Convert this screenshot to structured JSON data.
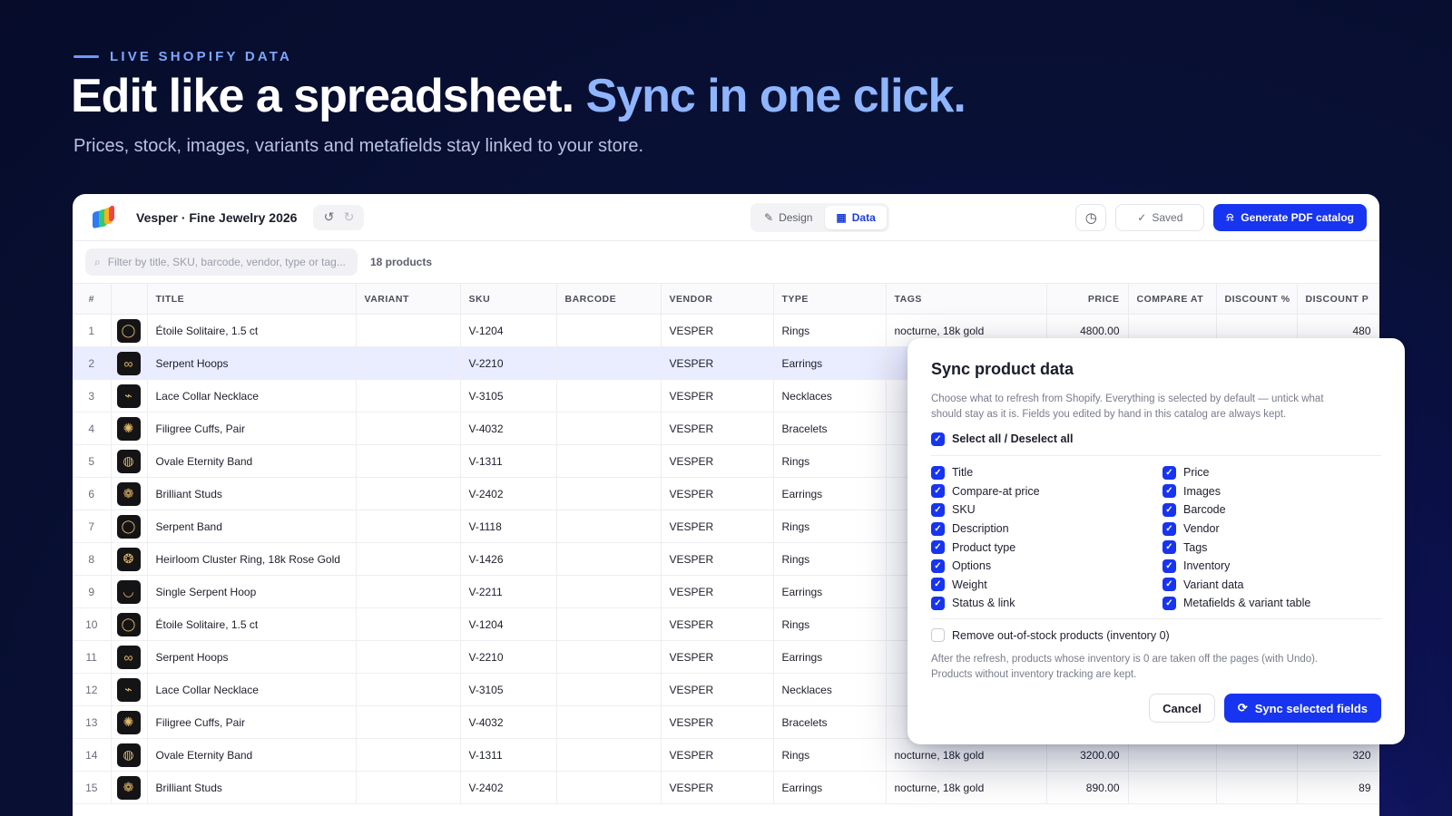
{
  "hero": {
    "eyebrow": "LIVE SHOPIFY DATA",
    "headline_main": "Edit like a spreadsheet.",
    "headline_accent": "Sync in one click.",
    "subhead": "Prices, stock, images, variants and metafields stay linked to your store."
  },
  "colors": {
    "accent": "#1734f0",
    "accent_light": "#8fb5ff",
    "background": "#081035"
  },
  "toolbar": {
    "doc_title": "Vesper · Fine Jewelry 2026",
    "undo_icon": "undo-icon",
    "redo_icon": "redo-icon",
    "modes": [
      {
        "label": "Design",
        "icon": "pencil-icon",
        "active": false
      },
      {
        "label": "Data",
        "icon": "table-icon",
        "active": true
      }
    ],
    "history_icon": "clock-icon",
    "saved_label": "Saved",
    "generate_label": "Generate PDF catalog"
  },
  "filter": {
    "placeholder": "Filter by title, SKU, barcode, vendor, type or tag...",
    "count": "18 products"
  },
  "table": {
    "columns": [
      "#",
      "",
      "TITLE",
      "VARIANT",
      "SKU",
      "BARCODE",
      "VENDOR",
      "TYPE",
      "TAGS",
      "PRICE",
      "COMPARE AT",
      "DISCOUNT %",
      "DISCOUNT P"
    ],
    "rows": [
      {
        "n": "1",
        "title": "Étoile Solitaire, 1.5 ct",
        "sku": "V-1204",
        "vendor": "VESPER",
        "type": "Rings",
        "tags": "nocturne, 18k gold",
        "price": "4800.00",
        "disc_p": "480"
      },
      {
        "n": "2",
        "title": "Serpent Hoops",
        "sku": "V-2210",
        "vendor": "VESPER",
        "type": "Earrings",
        "tags": "",
        "price": "",
        "disc_p": ""
      },
      {
        "n": "3",
        "title": "Lace Collar Necklace",
        "sku": "V-3105",
        "vendor": "VESPER",
        "type": "Necklaces",
        "tags": "",
        "price": "",
        "disc_p": ""
      },
      {
        "n": "4",
        "title": "Filigree Cuffs, Pair",
        "sku": "V-4032",
        "vendor": "VESPER",
        "type": "Bracelets",
        "tags": "",
        "price": "",
        "disc_p": ""
      },
      {
        "n": "5",
        "title": "Ovale Eternity Band",
        "sku": "V-1311",
        "vendor": "VESPER",
        "type": "Rings",
        "tags": "",
        "price": "",
        "disc_p": ""
      },
      {
        "n": "6",
        "title": "Brilliant Studs",
        "sku": "V-2402",
        "vendor": "VESPER",
        "type": "Earrings",
        "tags": "",
        "price": "",
        "disc_p": ""
      },
      {
        "n": "7",
        "title": "Serpent Band",
        "sku": "V-1118",
        "vendor": "VESPER",
        "type": "Rings",
        "tags": "",
        "price": "",
        "disc_p": ""
      },
      {
        "n": "8",
        "title": "Heirloom Cluster Ring, 18k Rose Gold",
        "sku": "V-1426",
        "vendor": "VESPER",
        "type": "Rings",
        "tags": "",
        "price": "",
        "disc_p": ""
      },
      {
        "n": "9",
        "title": "Single Serpent Hoop",
        "sku": "V-2211",
        "vendor": "VESPER",
        "type": "Earrings",
        "tags": "",
        "price": "",
        "disc_p": ""
      },
      {
        "n": "10",
        "title": "Étoile Solitaire, 1.5 ct",
        "sku": "V-1204",
        "vendor": "VESPER",
        "type": "Rings",
        "tags": "",
        "price": "",
        "disc_p": ""
      },
      {
        "n": "11",
        "title": "Serpent Hoops",
        "sku": "V-2210",
        "vendor": "VESPER",
        "type": "Earrings",
        "tags": "",
        "price": "",
        "disc_p": ""
      },
      {
        "n": "12",
        "title": "Lace Collar Necklace",
        "sku": "V-3105",
        "vendor": "VESPER",
        "type": "Necklaces",
        "tags": "",
        "price": "",
        "disc_p": ""
      },
      {
        "n": "13",
        "title": "Filigree Cuffs, Pair",
        "sku": "V-4032",
        "vendor": "VESPER",
        "type": "Bracelets",
        "tags": "",
        "price": "",
        "disc_p": ""
      },
      {
        "n": "14",
        "title": "Ovale Eternity Band",
        "sku": "V-1311",
        "vendor": "VESPER",
        "type": "Rings",
        "tags": "nocturne, 18k gold",
        "price": "3200.00",
        "disc_p": "320"
      },
      {
        "n": "15",
        "title": "Brilliant Studs",
        "sku": "V-2402",
        "vendor": "VESPER",
        "type": "Earrings",
        "tags": "nocturne, 18k gold",
        "price": "890.00",
        "disc_p": "89"
      }
    ],
    "thumb_glyphs": [
      "◯",
      "∞",
      "⌁",
      "✺",
      "◍",
      "❁",
      "◯",
      "❂",
      "◡",
      "◯",
      "∞",
      "⌁",
      "✺",
      "◍",
      "❁"
    ]
  },
  "modal": {
    "title": "Sync product data",
    "description": "Choose what to refresh from Shopify. Everything is selected by default — untick what should stay as it is. Fields you edited by hand in this catalog are always kept.",
    "select_all": "Select all / Deselect all",
    "fields_left": [
      "Title",
      "Compare-at price",
      "SKU",
      "Description",
      "Product type",
      "Options",
      "Weight",
      "Status & link"
    ],
    "fields_right": [
      "Price",
      "Images",
      "Barcode",
      "Vendor",
      "Tags",
      "Inventory",
      "Variant data",
      "Metafields & variant table"
    ],
    "remove_label": "Remove out-of-stock products (inventory 0)",
    "remove_checked": false,
    "note": "After the refresh, products whose inventory is 0 are taken off the pages (with Undo). Products without inventory tracking are kept.",
    "cancel_label": "Cancel",
    "sync_label": "Sync selected fields"
  }
}
